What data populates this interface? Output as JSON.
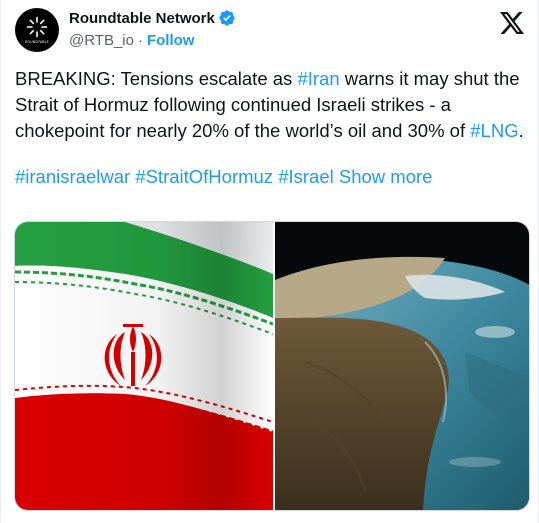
{
  "tweet": {
    "display_name": "Roundtable Network",
    "handle": "@RTB_io",
    "separator": "·",
    "follow_label": "Follow",
    "avatar_text": "ROUNDTABLE",
    "body_parts": [
      {
        "text": "BREAKING: Tensions escalate as ",
        "tag": false
      },
      {
        "text": "#Iran",
        "tag": true
      },
      {
        "text": " warns it may shut the Strait of Hormuz following continued Israeli strikes - a chokepoint for nearly 20% of the world’s oil and 30% of ",
        "tag": false
      },
      {
        "text": "#LNG",
        "tag": true
      },
      {
        "text": ".",
        "tag": false
      }
    ],
    "hashtags": [
      "#iranisraelwar",
      "#StraitOfHormuz",
      "#Israel"
    ],
    "show_more_label": "Show more",
    "media": [
      {
        "name": "iran-flag-image",
        "icon": "iran-flag"
      },
      {
        "name": "strait-satellite-image",
        "icon": "satellite-earth-view"
      }
    ]
  },
  "colors": {
    "accent": "#1d9bf0",
    "text": "#0f1419",
    "secondary": "#536471",
    "flag_green": "#239f40",
    "flag_red": "#da0000"
  }
}
